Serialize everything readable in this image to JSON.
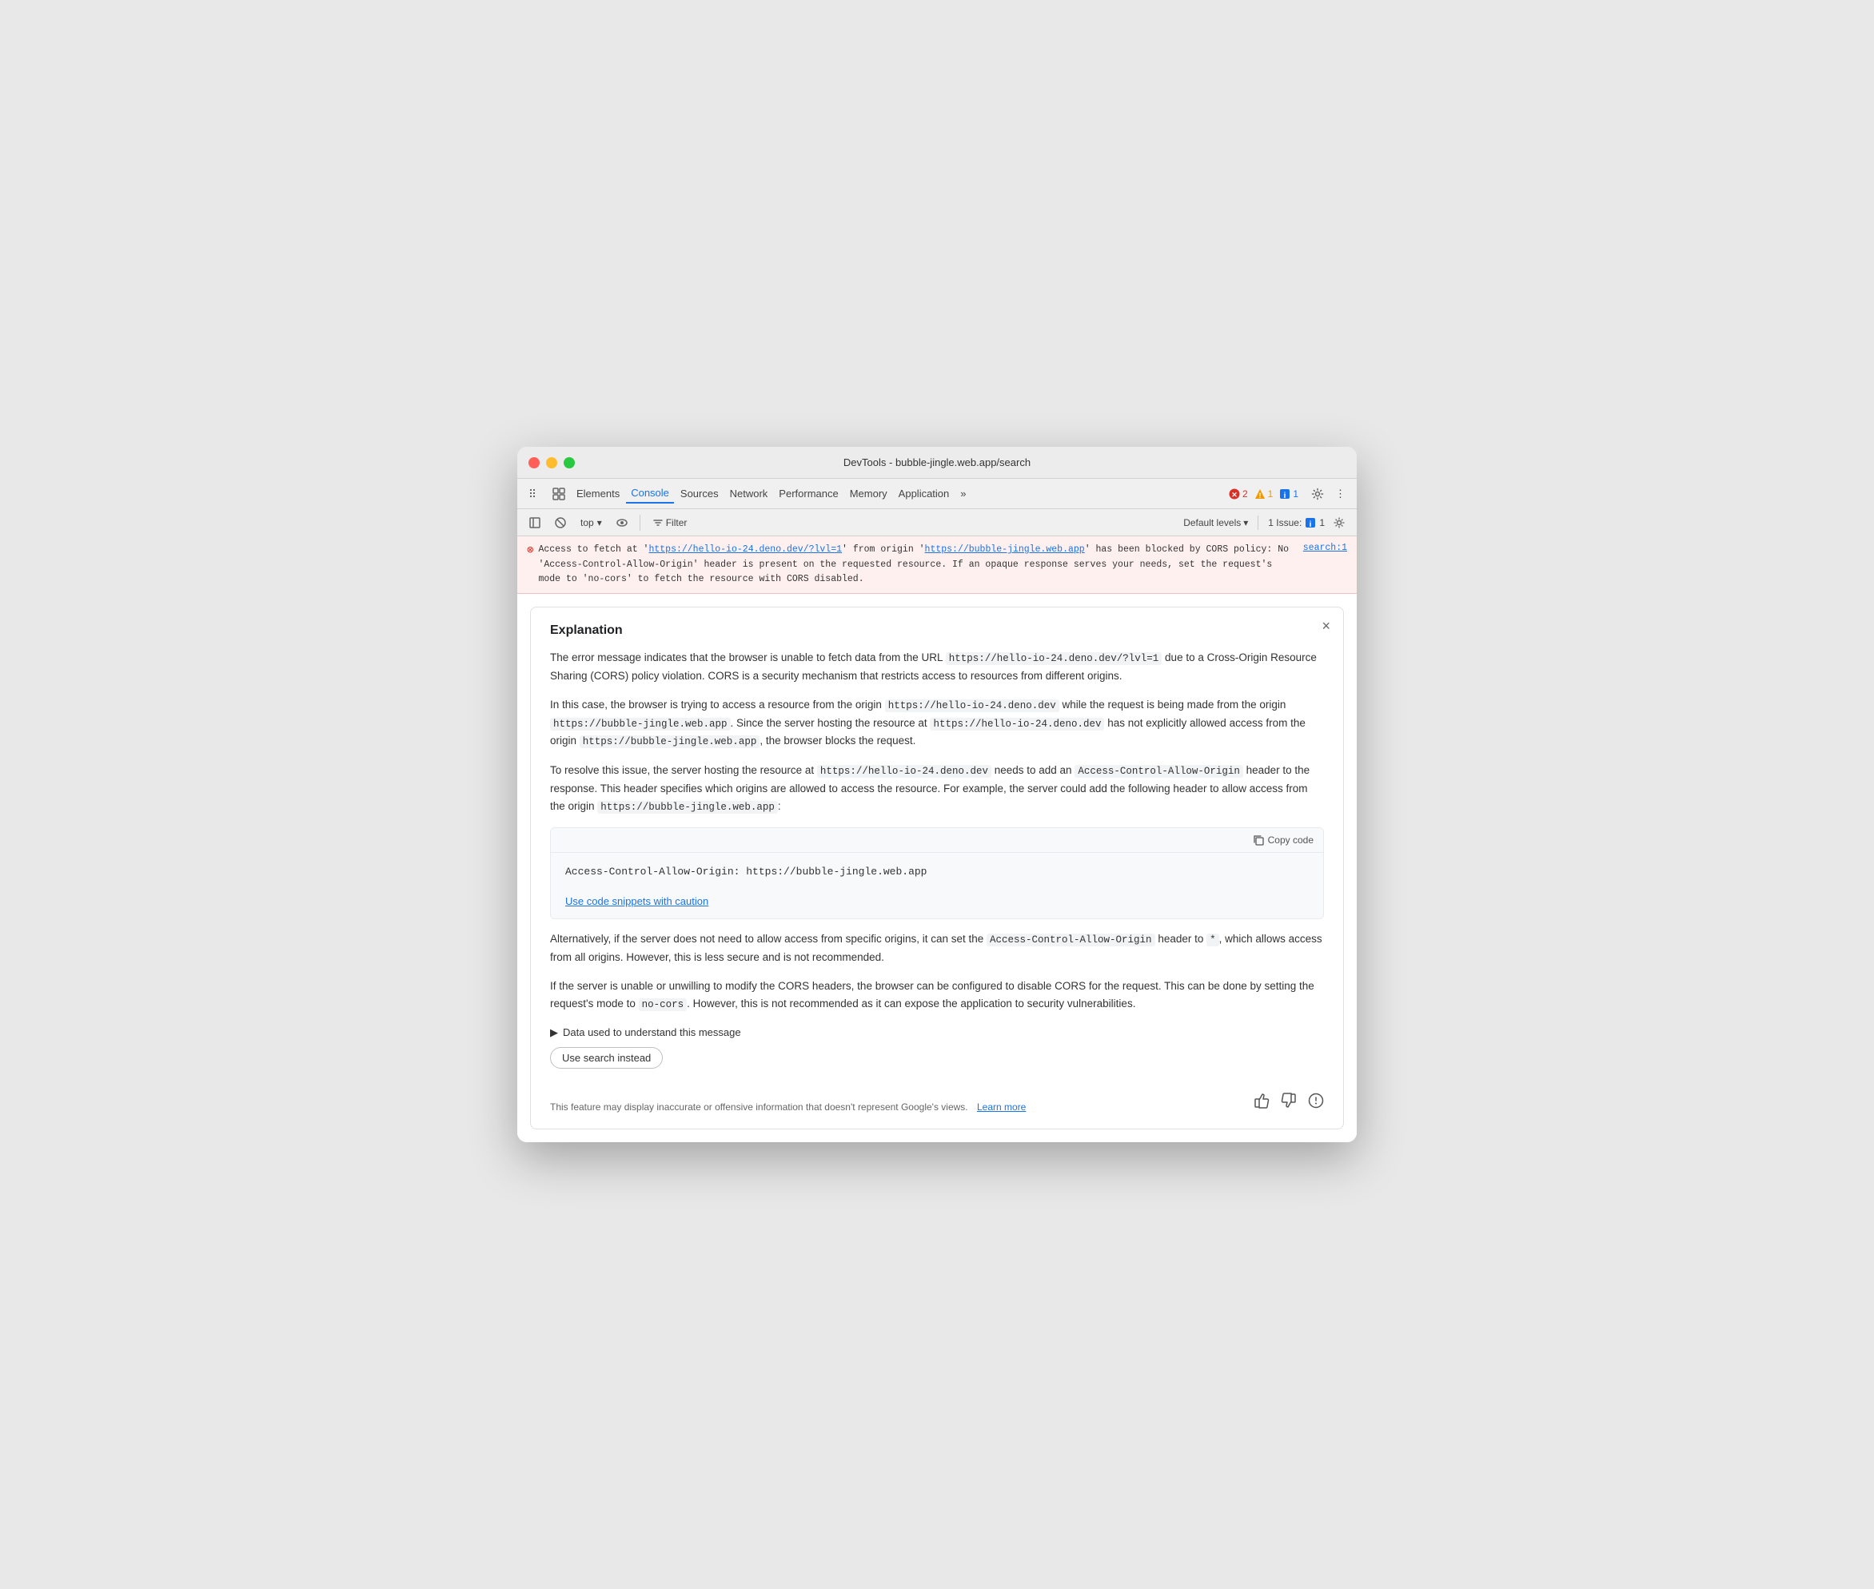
{
  "window": {
    "title": "DevTools - bubble-jingle.web.app/search"
  },
  "tabs": [
    {
      "label": "Elements",
      "active": false
    },
    {
      "label": "Console",
      "active": true
    },
    {
      "label": "Sources",
      "active": false
    },
    {
      "label": "Network",
      "active": false
    },
    {
      "label": "Performance",
      "active": false
    },
    {
      "label": "Memory",
      "active": false
    },
    {
      "label": "Application",
      "active": false
    },
    {
      "label": "»",
      "active": false
    }
  ],
  "badges": {
    "errors": "2",
    "warnings": "1",
    "issues": "1"
  },
  "toolbar2": {
    "top_label": "top",
    "filter_label": "Filter",
    "default_levels": "Default levels",
    "issues_label": "1 Issue:"
  },
  "error": {
    "message_start": "Access to fetch at '",
    "url1": "https://hello-io-24.deno.dev/?lvl=1",
    "message_mid": "' from origin '",
    "url2": "https://bubble-jingle.web.app",
    "message_end": "' has been blocked by CORS policy: No 'Access-Control-Allow-Origin' header is present on the requested resource. If an opaque response serves your needs, set the request's mode to 'no-cors' to fetch the resource with CORS disabled.",
    "source": "search:1"
  },
  "explanation": {
    "title": "Explanation",
    "para1": "The error message indicates that the browser is unable to fetch data from the URL",
    "para1_code": "https://hello-io-24.deno.dev/?lvl=1",
    "para1_end": "due to a Cross-Origin Resource Sharing (CORS) policy violation. CORS is a security mechanism that restricts access to resources from different origins.",
    "para2": "In this case, the browser is trying to access a resource from the origin",
    "para2_code1": "https://hello-io-24.deno.dev",
    "para2_mid": "while the request is being made from the origin",
    "para2_code2": "https://bubble-jingle.web.app",
    "para2_mid2": ". Since the server hosting the resource at",
    "para2_code3": "https://hello-io-24.deno.dev",
    "para2_end": "has not explicitly allowed access from the origin",
    "para2_code4": "https://bubble-jingle.web.app",
    "para2_final": ", the browser blocks the request.",
    "para3_start": "To resolve this issue, the server hosting the resource at",
    "para3_code1": "https://hello-io-24.deno.dev",
    "para3_mid": "needs to add an",
    "para3_code2": "Access-Control-Allow-Origin",
    "para3_mid2": "header to the response. This header specifies which origins are allowed to access the resource. For example, the server could add the following header to allow access from the origin",
    "para3_code3": "https://bubble-jingle.web.app",
    "para3_end": ":",
    "code_snippet": "Access-Control-Allow-Origin: https://bubble-jingle.web.app",
    "copy_label": "Copy code",
    "caution_link": "Use code snippets with caution",
    "para4_start": "Alternatively, if the server does not need to allow access from specific origins, it can set the",
    "para4_code": "Access-Control-Allow-Origin",
    "para4_mid": "header to",
    "para4_code2": "*",
    "para4_end": ", which allows access from all origins. However, this is less secure and is not recommended.",
    "para5_start": "If the server is unable or unwilling to modify the CORS headers, the browser can be configured to disable CORS for the request. This can be done by setting the request's mode to",
    "para5_code": "no-cors",
    "para5_end": ". However, this is not recommended as it can expose the application to security vulnerabilities.",
    "data_toggle": "Data used to understand this message",
    "use_search_label": "Use search instead",
    "disclaimer": "This feature may display inaccurate or offensive information that doesn't represent Google's views.",
    "learn_more": "Learn more"
  }
}
